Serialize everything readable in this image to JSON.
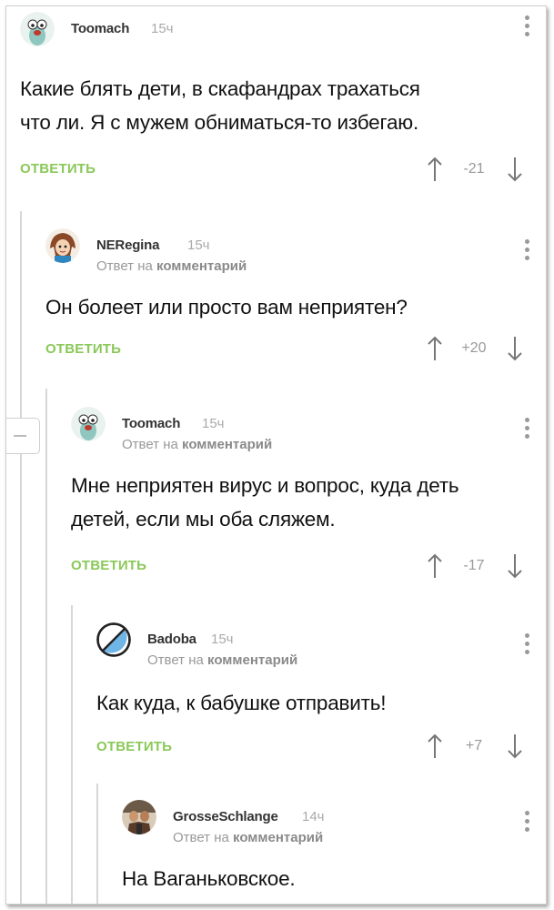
{
  "comments": [
    {
      "author": "Toomach",
      "time": "15ч",
      "reply_prefix": "",
      "reply_target": "",
      "lines": [
        "Какие блять дети, в скафандрах трахаться",
        "что ли. Я с мужем обниматься-то избегаю."
      ],
      "reply_label": "ОТВЕТИТЬ",
      "rating": "-21",
      "avatar": "cartoon-avatar"
    },
    {
      "author": "NERegina",
      "time": "15ч",
      "reply_prefix": "Ответ на",
      "reply_target": "комментарий",
      "lines": [
        "Он болеет или просто вам неприятен?"
      ],
      "reply_label": "ОТВЕТИТЬ",
      "rating": "+20",
      "avatar": "girl-avatar"
    },
    {
      "author": "Toomach",
      "time": "15ч",
      "reply_prefix": "Ответ на",
      "reply_target": "комментарий",
      "lines": [
        "Мне неприятен вирус и вопрос, куда деть",
        "детей, если мы оба сляжем."
      ],
      "reply_label": "ОТВЕТИТЬ",
      "rating": "-17",
      "avatar": "cartoon-avatar"
    },
    {
      "author": "Badoba",
      "time": "15ч",
      "reply_prefix": "Ответ на",
      "reply_target": "комментарий",
      "lines": [
        "Как куда, к бабушке отправить!"
      ],
      "reply_label": "ОТВЕТИТЬ",
      "rating": "+7",
      "avatar": "blocked-avatar"
    },
    {
      "author": "GrosseSchlange",
      "time": "14ч",
      "reply_prefix": "Ответ на",
      "reply_target": "комментарий",
      "lines": [
        "На Ваганьковское."
      ],
      "reply_label": "",
      "rating": "",
      "avatar": "photo-avatar"
    }
  ],
  "colors": {
    "reply_green": "#8ac858",
    "muted": "#999999",
    "thread_line": "#d7d7d7"
  }
}
